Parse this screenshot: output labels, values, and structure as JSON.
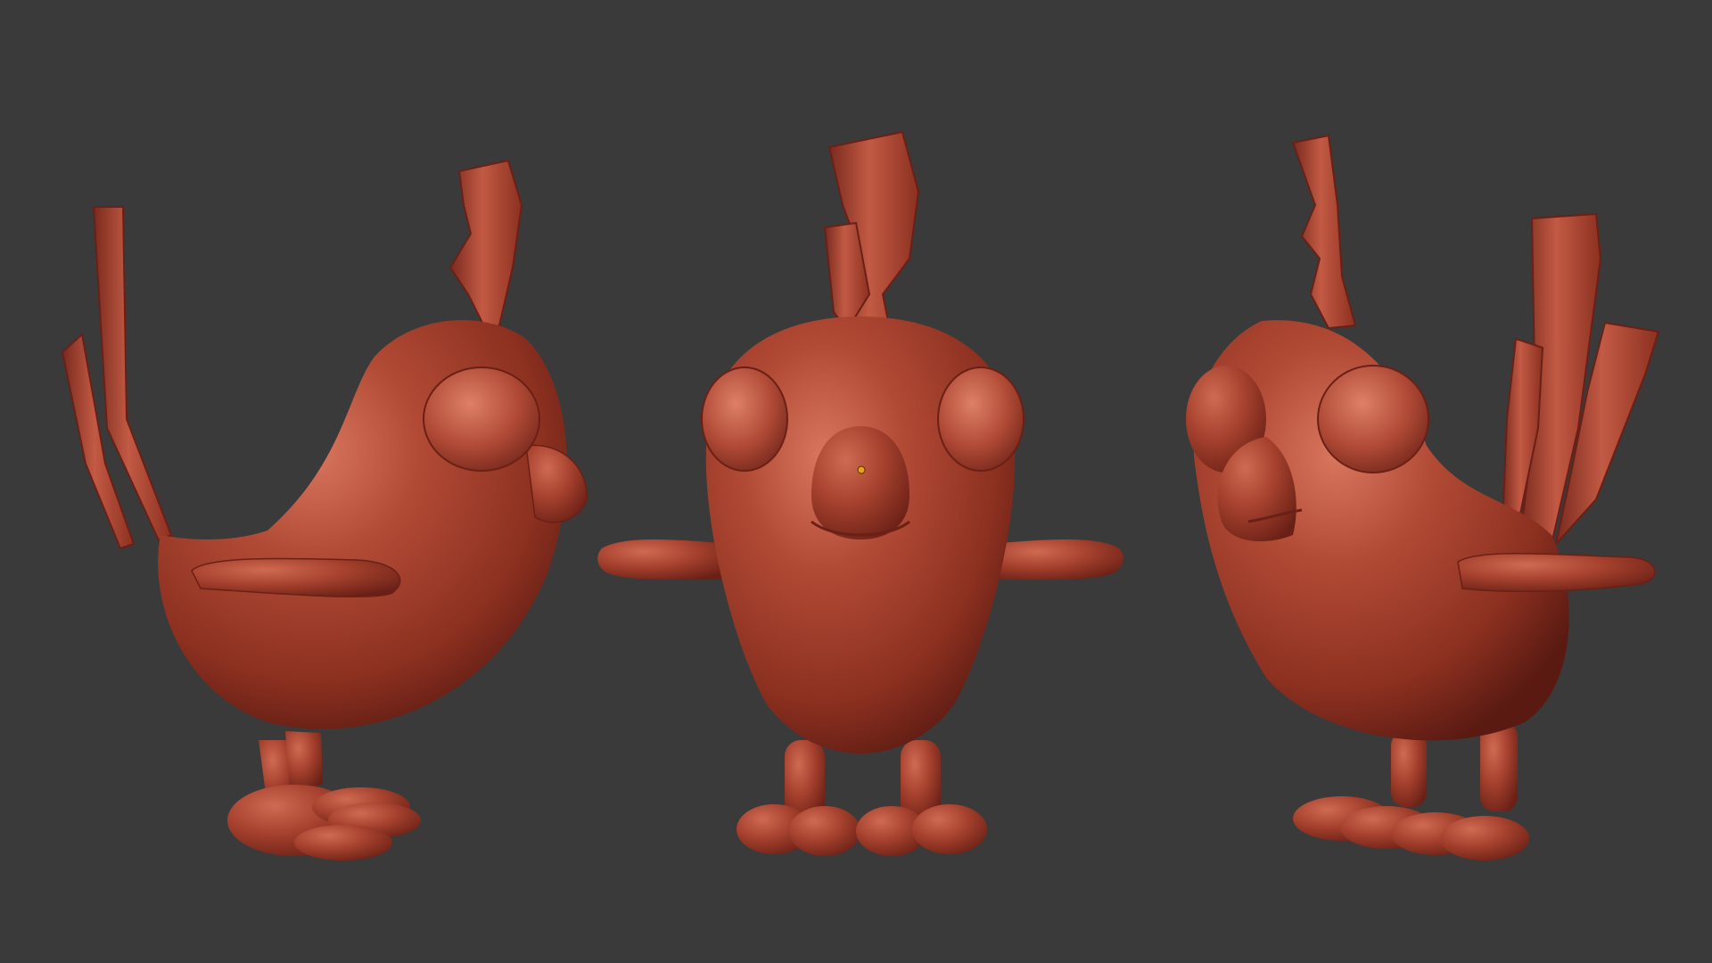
{
  "viewport": {
    "background_color": "#3a3a3a"
  },
  "model": {
    "material_color": "#a8402e",
    "highlight_color": "#d9765e",
    "shadow_color": "#5a1a12",
    "edge_color": "#7a2a1e",
    "pivot_color": "#e8a020"
  },
  "views": [
    {
      "id": "side-left",
      "label": ""
    },
    {
      "id": "front",
      "label": ""
    },
    {
      "id": "side-right",
      "label": ""
    }
  ],
  "pivot_marker": {
    "icon": "origin-dot-icon"
  }
}
